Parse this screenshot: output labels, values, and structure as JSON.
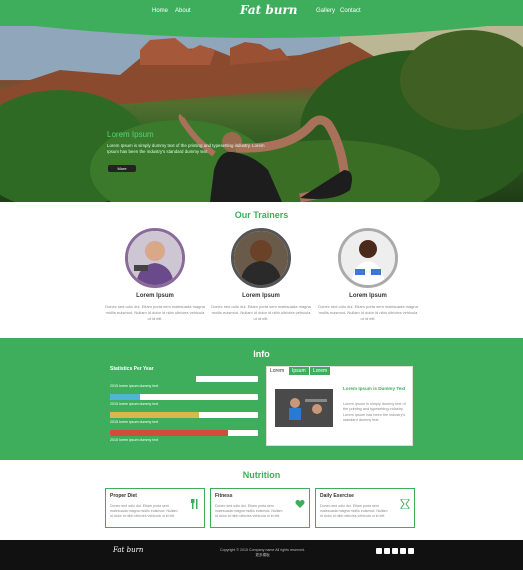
{
  "nav": {
    "home": "Home",
    "about": "About",
    "logo": "Fat burn",
    "gallery": "Gallery",
    "contact": "Contact"
  },
  "hero": {
    "title": "Lorem Ipsum",
    "text": "Lorem Ipsum is simply dummy text of the printing and typesetting industry. Lorem Ipsum has been the industry's standard dummy text",
    "button": "More"
  },
  "trainers": {
    "title": "Our Trainers",
    "items": [
      {
        "name": "Lorem Ipsum",
        "text": "Donec sed odio dui. Etiam porta sem malesuada magna mollis euismod. Nullam id dolor id nibh ultricies vehicula ut id elit."
      },
      {
        "name": "Lorem Ipsum",
        "text": "Donec sed odio dui. Etiam porta sem malesuada magna mollis euismod. Nullam id dolor id nibh ultricies vehicula ut id elit."
      },
      {
        "name": "Lorem Ipsum",
        "text": "Donec sed odio dui. Etiam porta sem malesuada magna mollis euismod. Nullam id dolor id nibh ultricies vehicula ut id elit."
      }
    ]
  },
  "info": {
    "title": "Info",
    "stats_title": "Statistics Per Year",
    "stats": [
      {
        "label": "2015 lorem ipsum dummy text",
        "value": 0.58,
        "color": "#3fae5c"
      },
      {
        "label": "2015 lorem ipsum dummy text",
        "value": 0.2,
        "color": "#4fb6d2"
      },
      {
        "label": "2015 lorem ipsum dummy text",
        "value": 0.6,
        "color": "#d8b84c"
      },
      {
        "label": "2015 lorem ipsum dummy text",
        "value": 0.8,
        "color": "#d24c3a"
      }
    ],
    "tabs": [
      "Lorem",
      "Ipsum",
      "Lorem"
    ],
    "tab_heading": "Lorem Ipsum is Dummy Text",
    "tab_text": "Lorem Ipsum is simply dummy text of the printing and typesetting industry. Lorem Ipsum has been the industry's standard dummy text."
  },
  "nutrition": {
    "title": "Nutrition",
    "cards": [
      {
        "title": "Proper Diet",
        "text": "Donec sed odio dui. Etiam porta sem malesuada magna mollis euismod. Nullam id dolor id nibh ultricies vehicula ut id elit."
      },
      {
        "title": "Fitness",
        "text": "Donec sed odio dui. Etiam porta sem malesuada magna mollis euismod. Nullam id dolor id nibh ultricies vehicula ut id elit."
      },
      {
        "title": "Daily Exercise",
        "text": "Donec sed odio dui. Etiam porta sem malesuada magna mollis euismod. Nullam id dolor id nibh ultricies vehicula ut id elit."
      }
    ]
  },
  "footer": {
    "logo": "Fat burn",
    "copyright": "Copyright © 2015 Company name All rights reserved.",
    "sub": "更多模板"
  },
  "colors": {
    "brand": "#3fae5c",
    "footer": "#111111"
  }
}
